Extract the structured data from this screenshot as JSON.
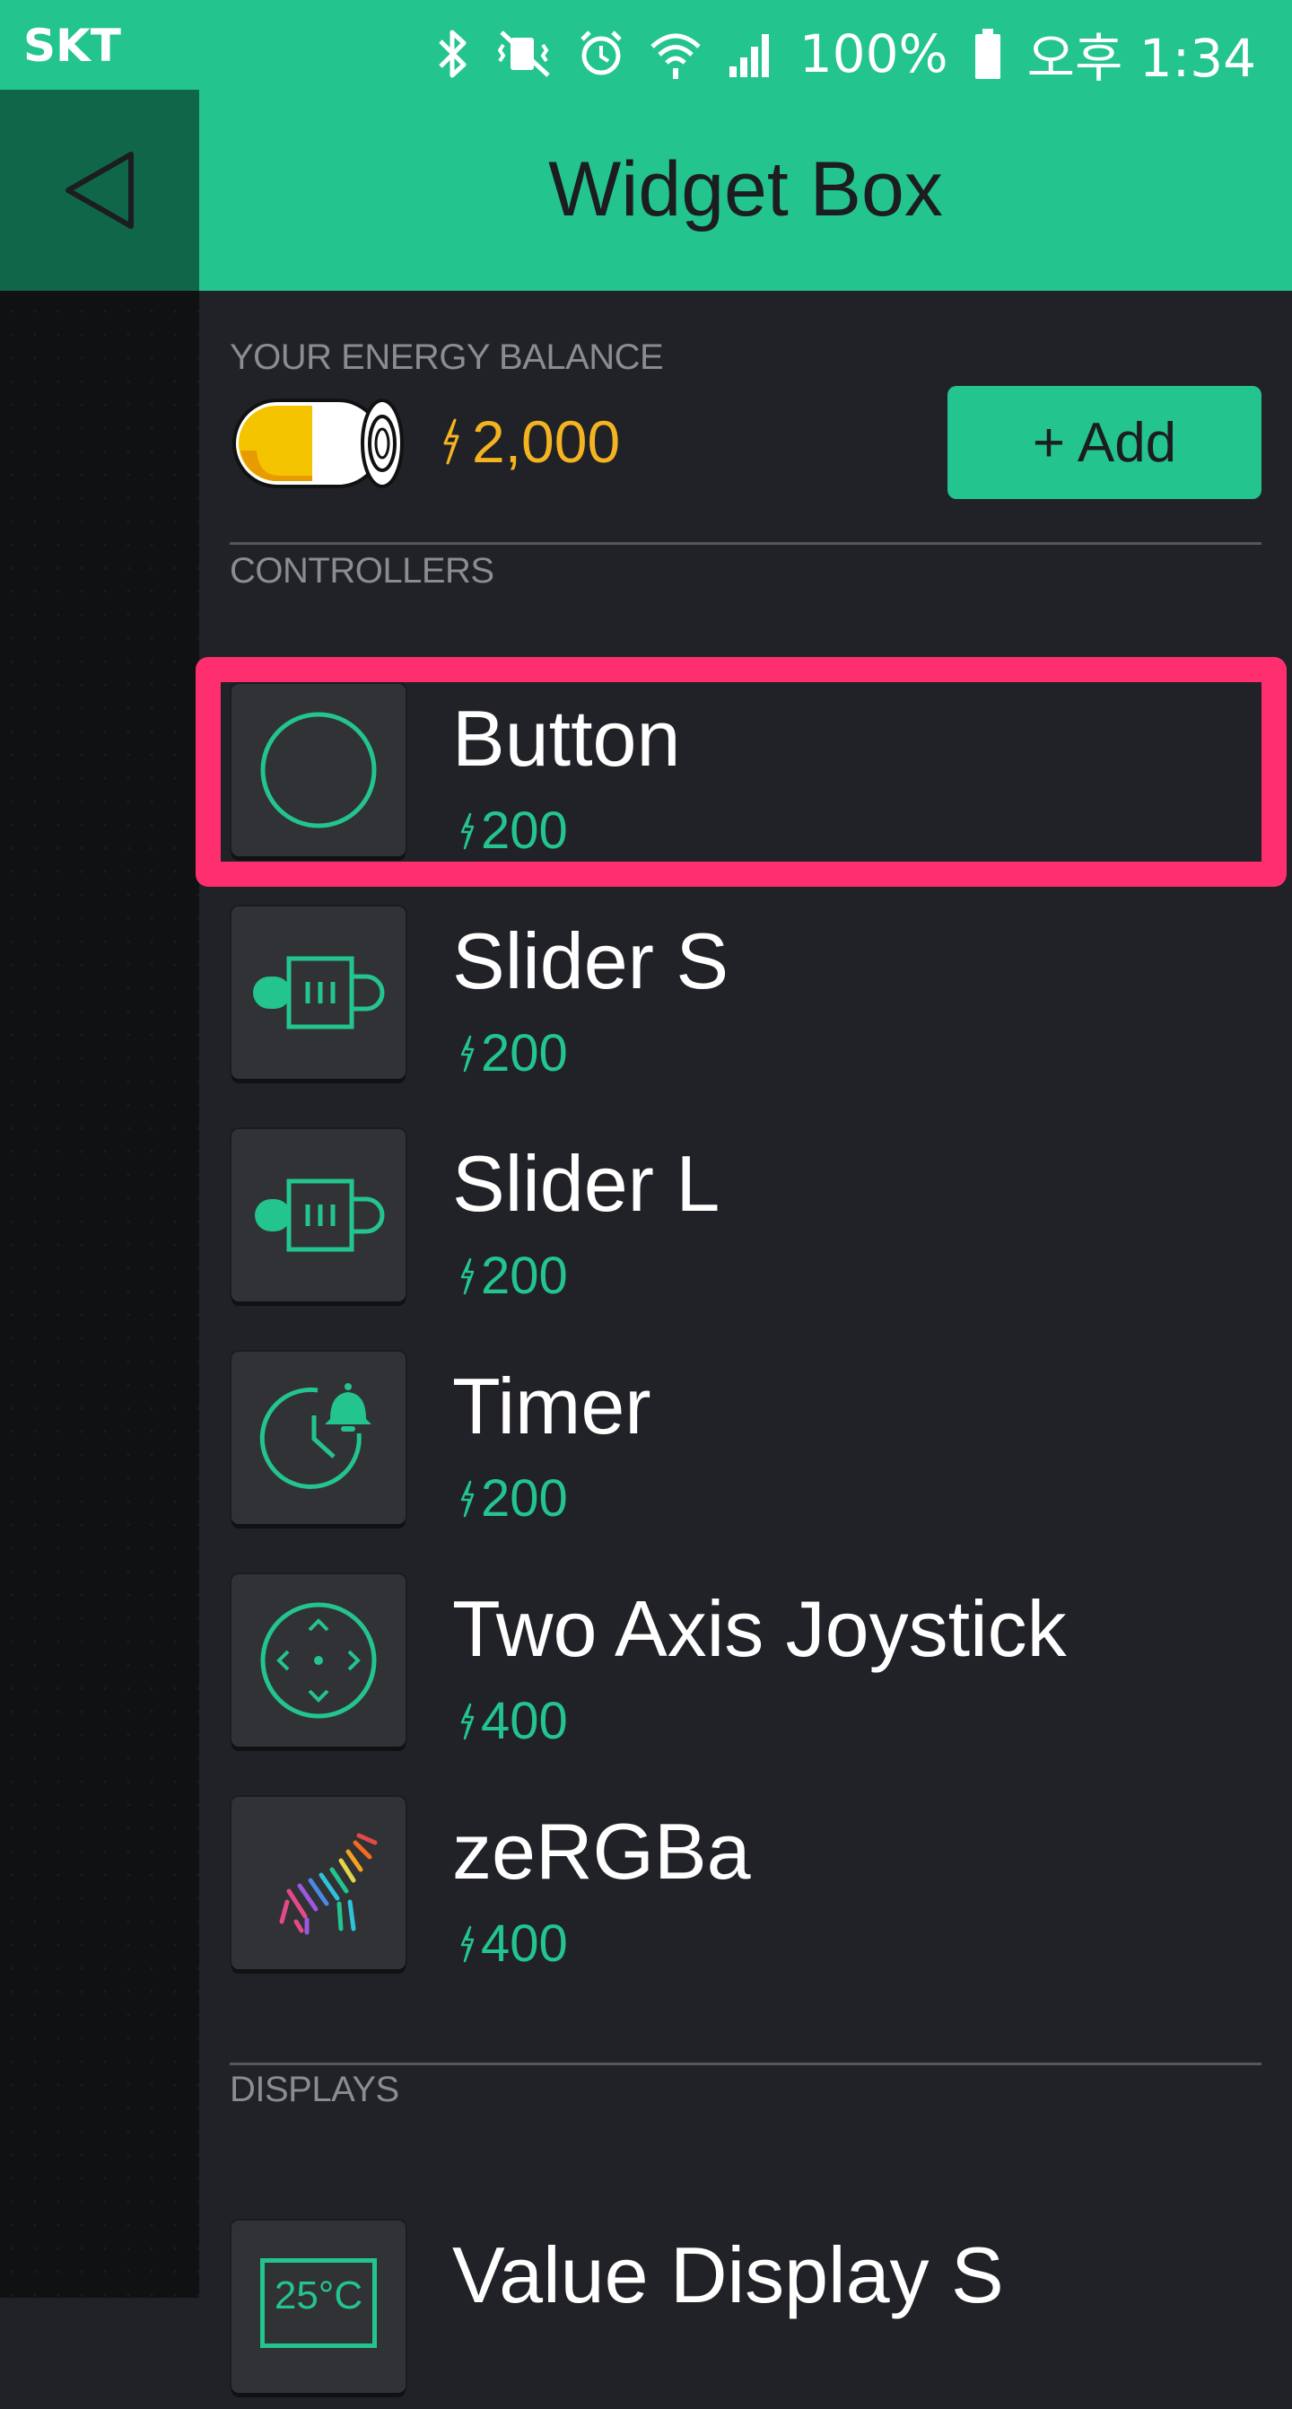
{
  "status_bar": {
    "carrier": "SKT",
    "battery_percent": "100%",
    "time": "오후 1:34"
  },
  "header": {
    "title": "Widget Box"
  },
  "energy": {
    "label": "YOUR ENERGY BALANCE",
    "balance": "2,000",
    "add_label": "+ Add"
  },
  "sections": {
    "controllers_label": "CONTROLLERS",
    "displays_label": "DISPLAYS"
  },
  "widgets": [
    {
      "name": "Button",
      "cost": "200",
      "icon": "button-circle-icon"
    },
    {
      "name": "Slider S",
      "cost": "200",
      "icon": "slider-icon"
    },
    {
      "name": "Slider L",
      "cost": "200",
      "icon": "slider-icon"
    },
    {
      "name": "Timer",
      "cost": "200",
      "icon": "timer-icon"
    },
    {
      "name": "Two Axis Joystick",
      "cost": "400",
      "icon": "joystick-icon"
    },
    {
      "name": "zeRGBa",
      "cost": "400",
      "icon": "zebra-icon"
    },
    {
      "name": "Value Display S",
      "cost": "",
      "icon": "value-display-icon",
      "icon_text": "25°C"
    }
  ],
  "colors": {
    "accent": "#23c48e",
    "energy": "#f4b321",
    "highlight": "#ff2e6f",
    "background": "#212227"
  }
}
